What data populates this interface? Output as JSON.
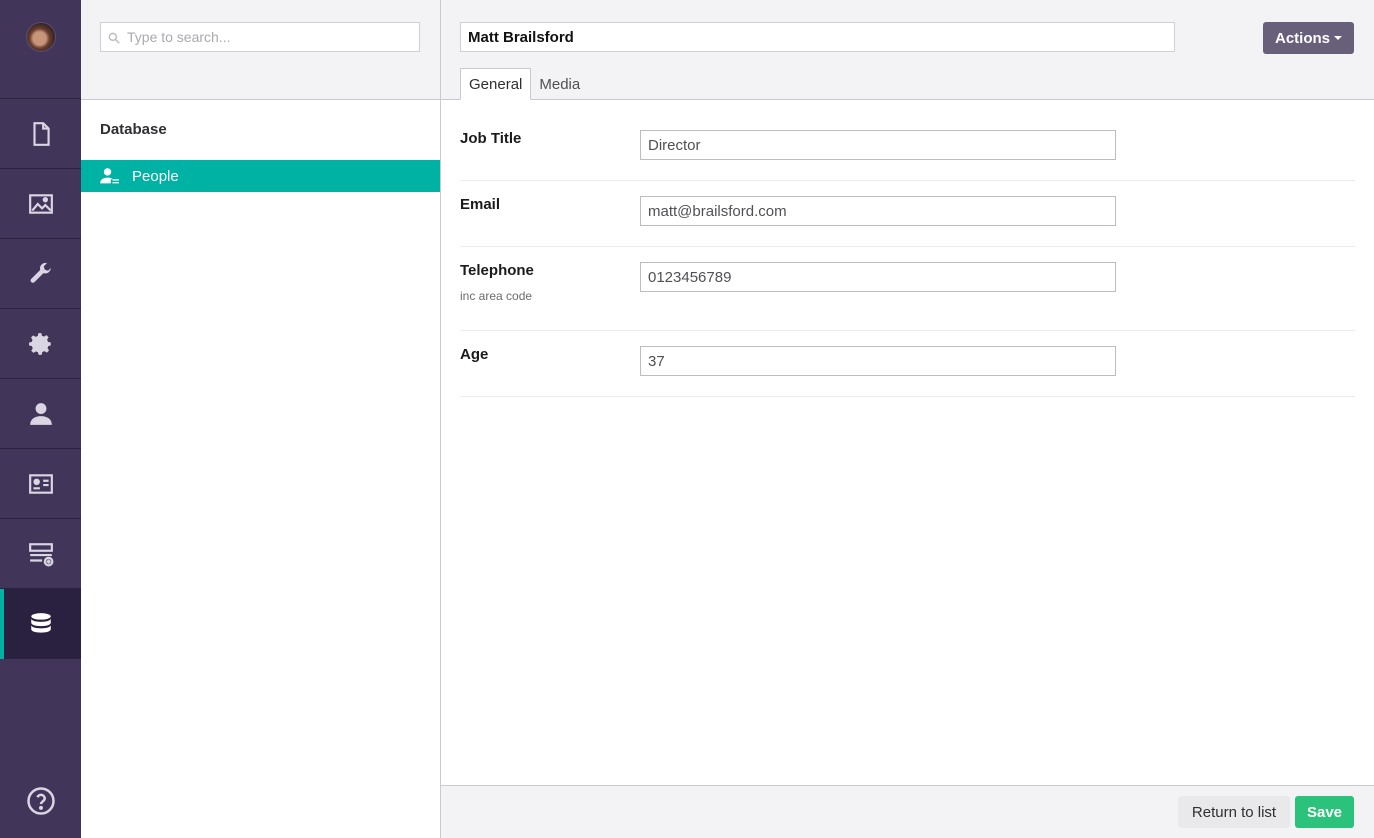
{
  "colors": {
    "rail_bg": "#413659",
    "accent": "#00b2a3",
    "actions_button": "#68607a",
    "save_button": "#2bc37c"
  },
  "rail": {
    "sections": [
      {
        "icon": "document-icon"
      },
      {
        "icon": "image-icon"
      },
      {
        "icon": "wrench-icon"
      },
      {
        "icon": "gear-icon"
      },
      {
        "icon": "user-icon"
      },
      {
        "icon": "id-card-icon"
      },
      {
        "icon": "form-add-icon"
      },
      {
        "icon": "database-icon",
        "active": true
      }
    ],
    "help_icon": "help-icon"
  },
  "tree": {
    "search_placeholder": "Type to search...",
    "root_label": "Database",
    "items": [
      {
        "label": "People",
        "icon": "user-list-icon",
        "selected": true
      }
    ]
  },
  "editor": {
    "name": "Matt Brailsford",
    "actions_label": "Actions",
    "tabs": [
      {
        "label": "General",
        "active": true
      },
      {
        "label": "Media",
        "active": false
      }
    ],
    "properties": [
      {
        "label": "Job Title",
        "description": "",
        "value": "Director"
      },
      {
        "label": "Email",
        "description": "",
        "value": "matt@brailsford.com"
      },
      {
        "label": "Telephone",
        "description": "inc area code",
        "value": "0123456789"
      },
      {
        "label": "Age",
        "description": "",
        "value": "37"
      }
    ],
    "return_label": "Return to list",
    "save_label": "Save"
  }
}
